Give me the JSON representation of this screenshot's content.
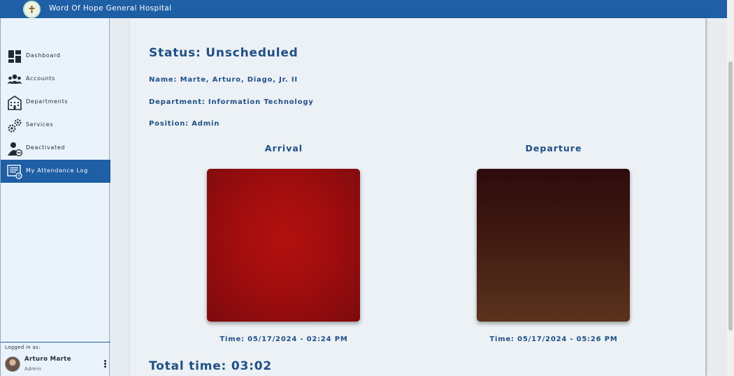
{
  "header": {
    "title": "Word Of Hope General Hospital",
    "logo_icon": "hospital-cross-logo"
  },
  "sidebar": {
    "items": [
      {
        "label": "Dashboard",
        "icon": "dashboard-icon",
        "active": false
      },
      {
        "label": "Accounts",
        "icon": "users-icon",
        "active": false
      },
      {
        "label": "Departments",
        "icon": "building-icon",
        "active": false
      },
      {
        "label": "Services",
        "icon": "gears-icon",
        "active": false
      },
      {
        "label": "Deactivated",
        "icon": "user-minus-icon",
        "active": false
      },
      {
        "label": "My Attendance Log",
        "icon": "attendance-log-icon",
        "active": true
      }
    ],
    "user": {
      "logged_in_label": "Logged in as:",
      "name": "Arturo Marte",
      "role": "Admin"
    }
  },
  "main": {
    "status": "Status: Unscheduled",
    "name": "Name: Marte, Arturo, Diago, Jr. II",
    "department": "Department: Information Technology",
    "position": "Position: Admin",
    "arrival": {
      "title": "Arrival",
      "time": "Time: 05/17/2024 - 02:24 PM"
    },
    "departure": {
      "title": "Departure",
      "time": "Time: 05/17/2024 - 05:26 PM"
    },
    "total_time": "Total time: 03:02"
  },
  "colors": {
    "primary": "#1e5fa5",
    "text_blue": "#1f4f86",
    "sidebar_bg": "#eaf3fc"
  }
}
